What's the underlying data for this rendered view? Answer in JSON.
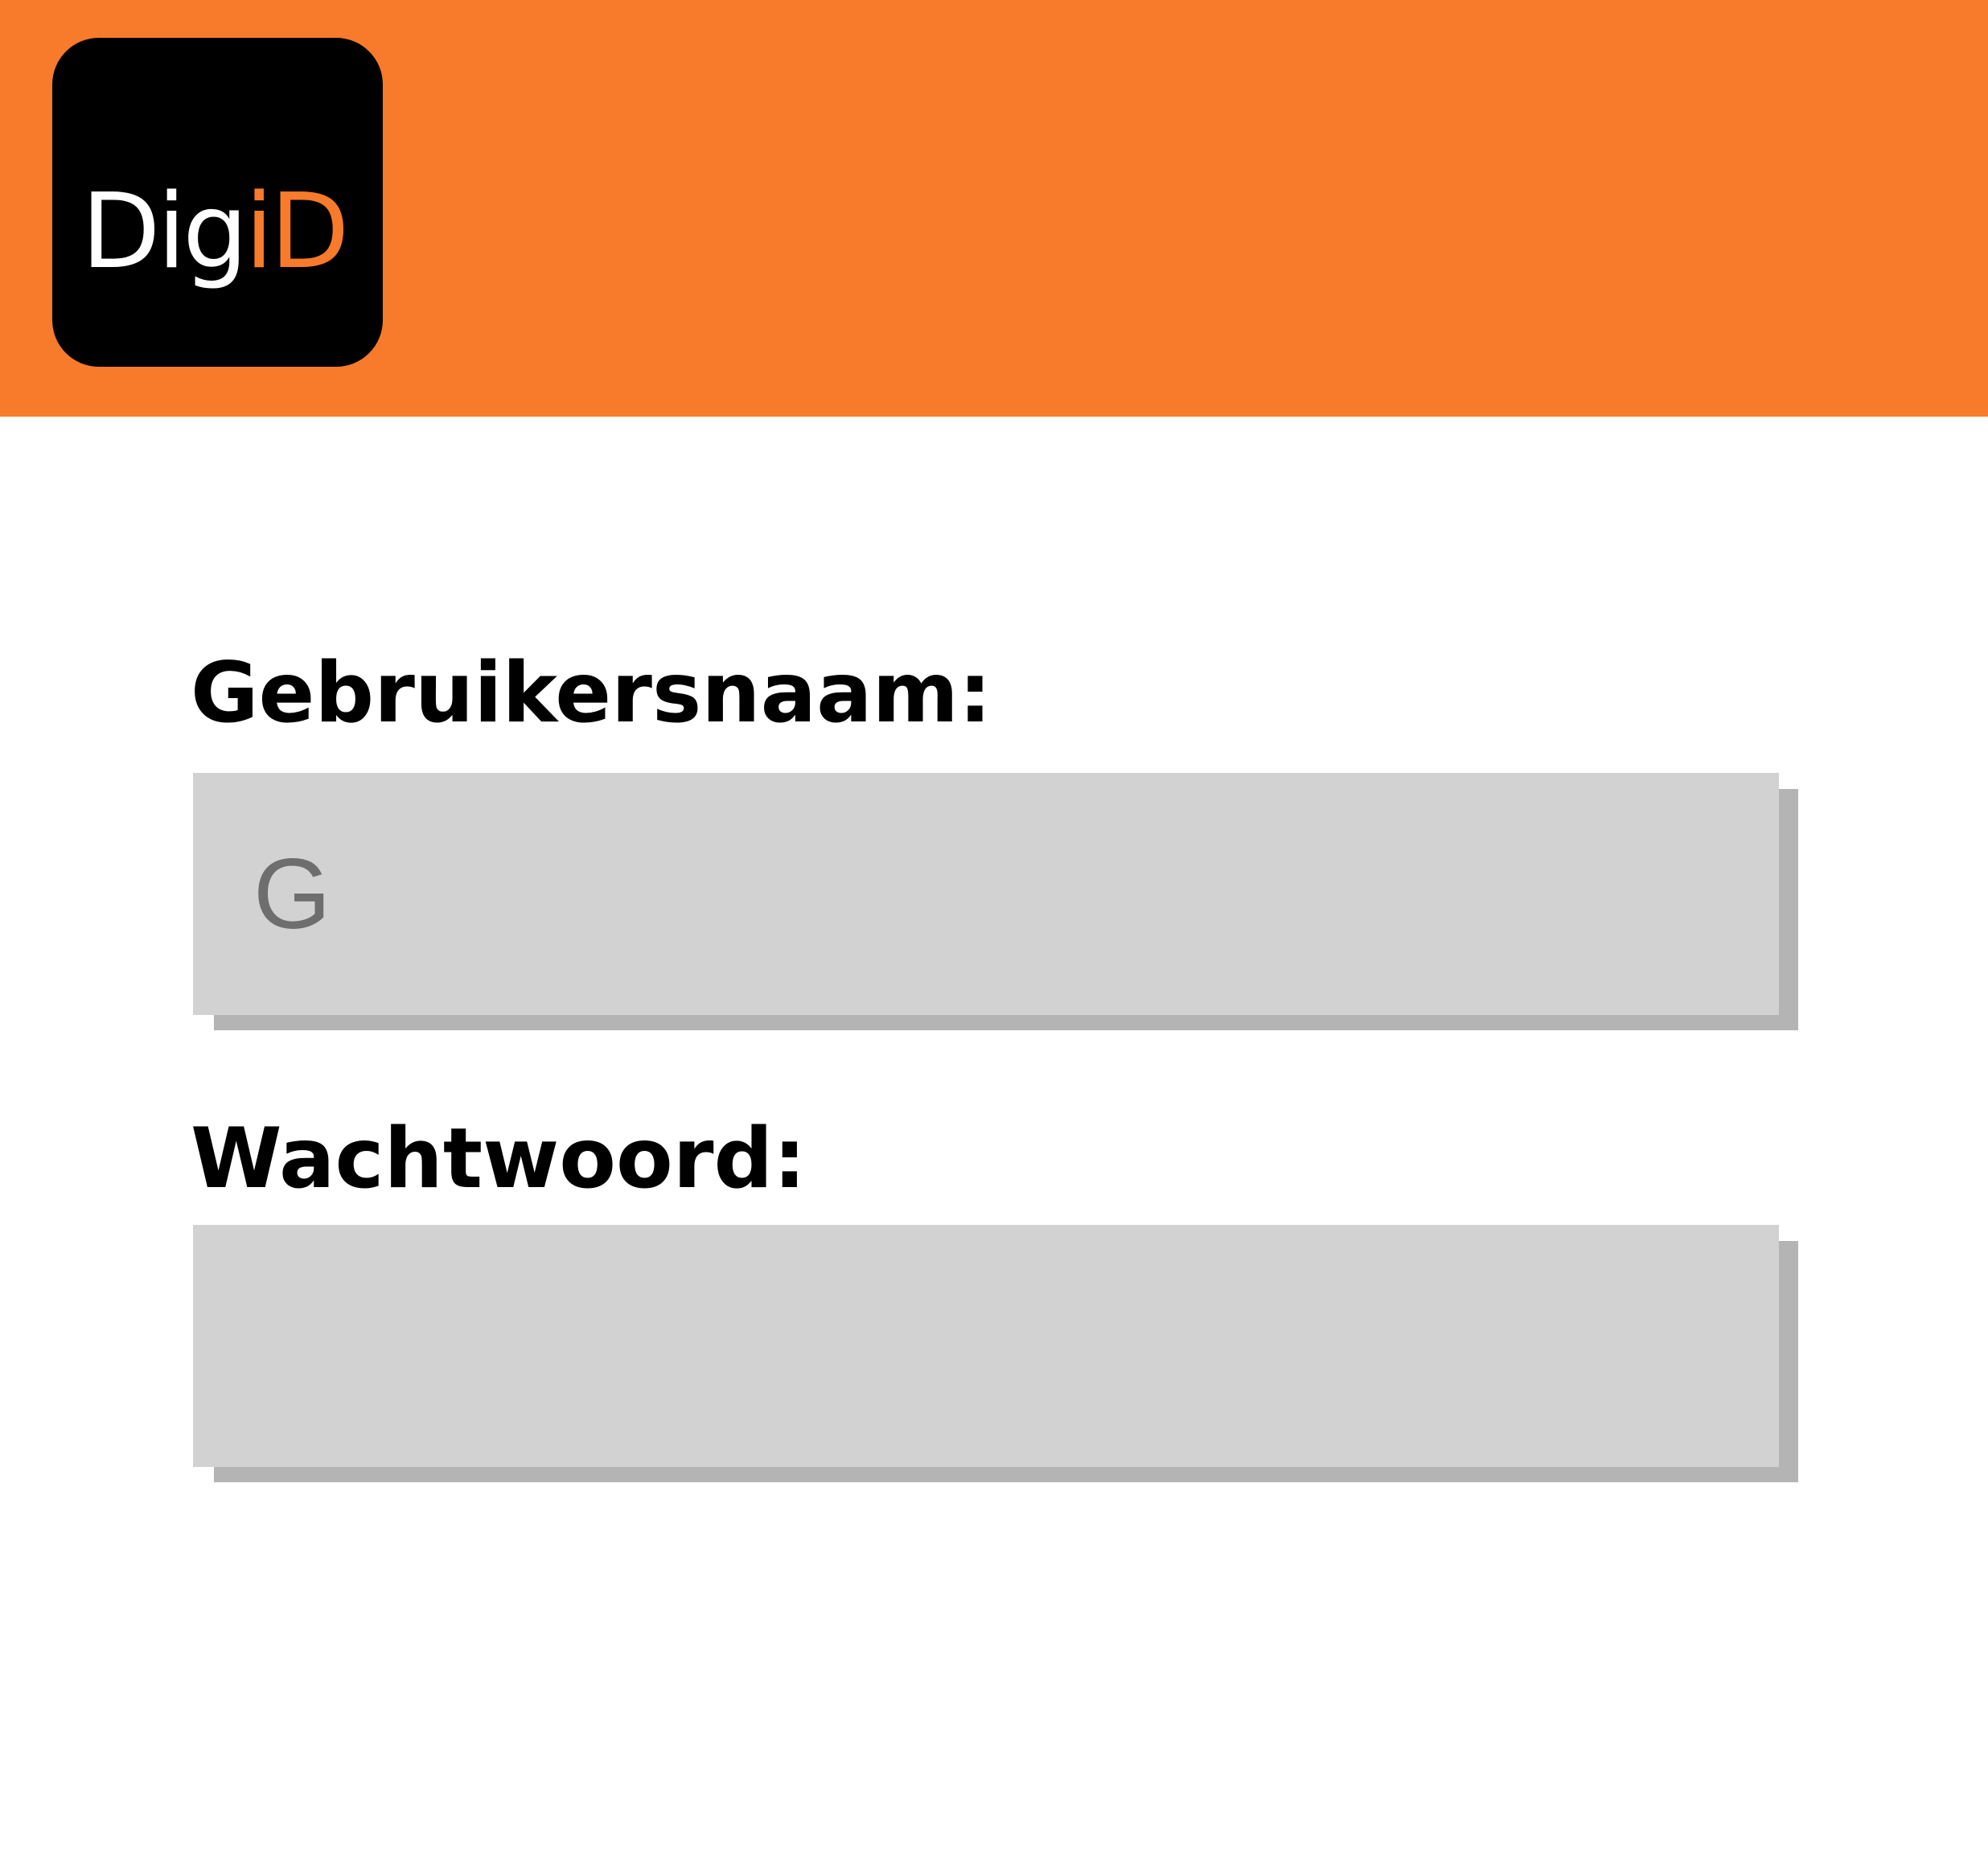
{
  "colors": {
    "header_background": "#f77b2b",
    "logo_background": "#000000",
    "logo_text_white": "#ffffff",
    "logo_text_orange": "#f77b2b",
    "input_background": "#d2d2d2",
    "input_shadow": "#b4b4b4",
    "input_text": "#6e6e6e",
    "label_text": "#000000"
  },
  "header": {
    "logo": {
      "text_white": "Dig",
      "text_orange": "iD"
    }
  },
  "form": {
    "username": {
      "label": "Gebruikersnaam:",
      "value": "G"
    },
    "password": {
      "label": "Wachtwoord:",
      "value": ""
    }
  }
}
